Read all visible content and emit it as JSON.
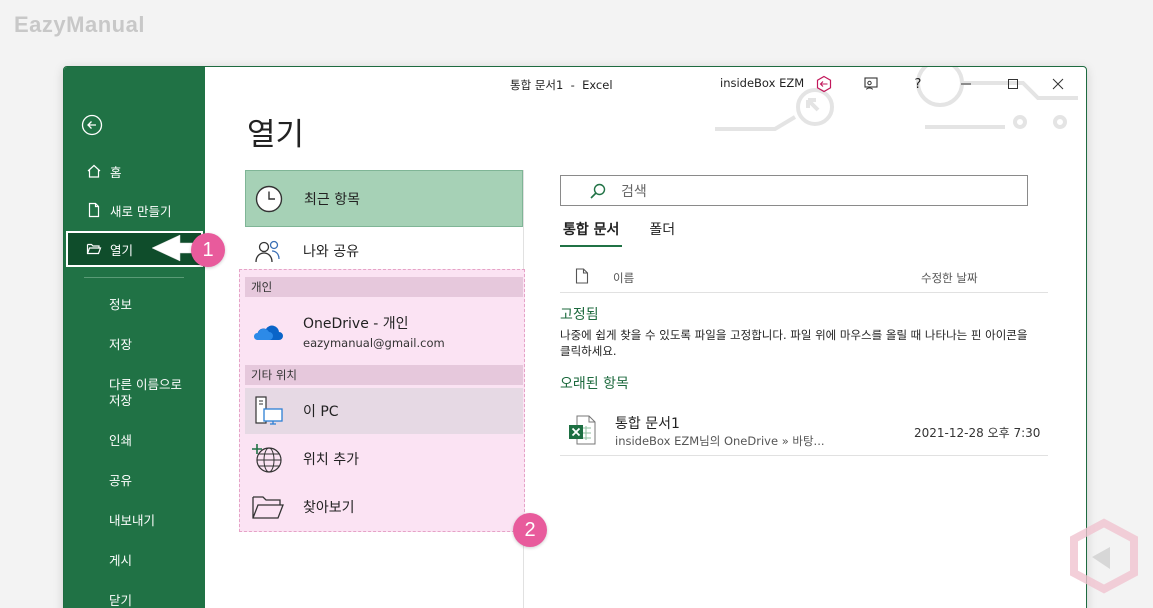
{
  "watermark": "EazyManual",
  "titlebar": {
    "title": "통합 문서1  -  Excel",
    "user": "insideBox EZM",
    "help": "?"
  },
  "sidebar": {
    "items": [
      {
        "label": "홈",
        "icon": "home-icon"
      },
      {
        "label": "새로 만들기",
        "icon": "new-document-icon"
      },
      {
        "label": "열기",
        "icon": "open-folder-icon"
      }
    ],
    "sub_items": [
      "정보",
      "저장",
      "다른 이름으로",
      "저장",
      "인쇄",
      "공유",
      "내보내기",
      "게시",
      "닫기"
    ]
  },
  "page_title": "열기",
  "locations": {
    "recent": "최근 항목",
    "shared": "나와 공유",
    "personal_header": "개인",
    "onedrive_name": "OneDrive - 개인",
    "onedrive_email": "eazymanual@gmail.com",
    "other_header": "기타 위치",
    "this_pc": "이 PC",
    "add_place": "위치 추가",
    "browse": "찾아보기"
  },
  "search": {
    "placeholder": "검색"
  },
  "tabs": [
    {
      "label": "통합 문서",
      "active": true
    },
    {
      "label": "폴더",
      "active": false
    }
  ],
  "file_list": {
    "col_name": "이름",
    "col_date": "수정한 날짜",
    "pinned_title": "고정됨",
    "pinned_desc": "나중에 쉽게 찾을 수 있도록 파일을 고정합니다. 파일 위에 마우스를 올릴 때 나타나는 핀 아이콘을 클릭하세요.",
    "older_title": "오래된 항목",
    "files": [
      {
        "name": "통합 문서1",
        "path": "insideBox EZM님의 OneDrive » 바탕...",
        "date": "2021-12-28 오후 7:30"
      }
    ]
  },
  "annotations": {
    "badge1": "1",
    "badge2": "2"
  },
  "colors": {
    "accent": "#207245",
    "selected": "#a6d1b6",
    "badge": "#e85b9c",
    "highlight": "#fbe3f3"
  }
}
